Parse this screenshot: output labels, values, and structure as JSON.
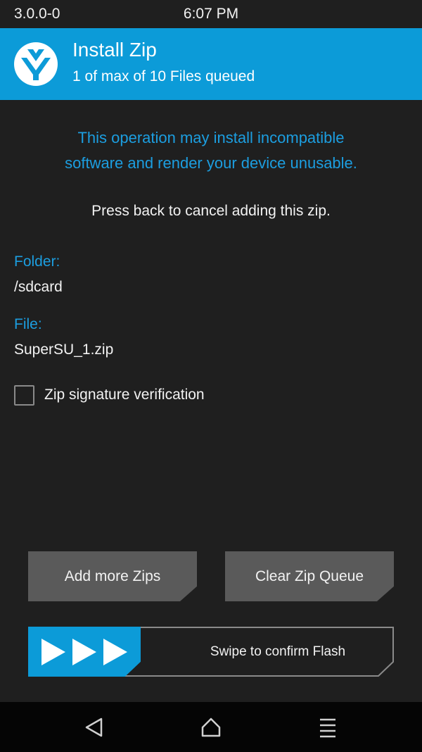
{
  "status_bar": {
    "version": "3.0.0-0",
    "time": "6:07 PM"
  },
  "header": {
    "title": "Install Zip",
    "subtitle": "1 of max of 10 Files queued",
    "logo_icon": "twrp-logo-icon"
  },
  "warning": {
    "line1": "This operation may install incompatible",
    "line2": "software and render your device unusable."
  },
  "cancel_hint": "Press back to cancel adding this zip.",
  "folder": {
    "label": "Folder:",
    "value": "/sdcard"
  },
  "file": {
    "label": "File:",
    "value": "SuperSU_1.zip"
  },
  "signature_check": {
    "label": "Zip signature verification",
    "checked": false
  },
  "buttons": {
    "add_more": "Add more Zips",
    "clear_queue": "Clear Zip Queue"
  },
  "swipe": {
    "label": "Swipe to confirm Flash"
  },
  "nav": {
    "back_icon": "back-triangle-icon",
    "home_icon": "home-icon",
    "menu_icon": "menu-lines-icon"
  },
  "colors": {
    "accent": "#0c9bd8",
    "warning_text": "#1c9ee0",
    "background": "#1f1f1f",
    "button": "#5a5a5a",
    "nav_bar": "#050505"
  }
}
